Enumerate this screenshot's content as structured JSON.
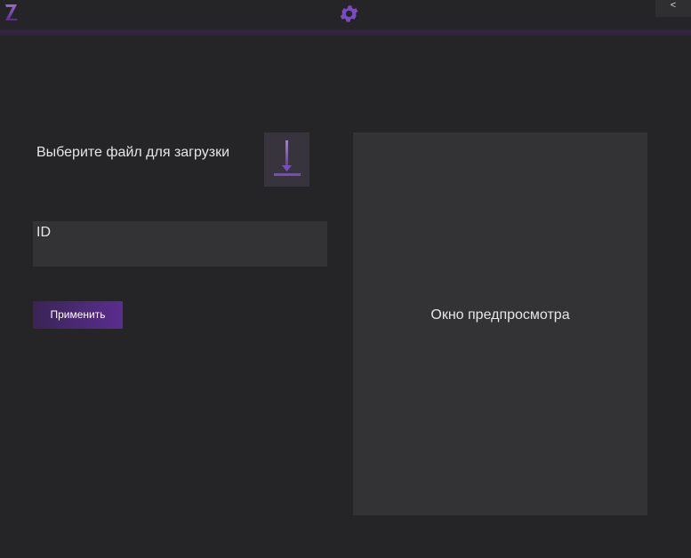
{
  "topbar": {
    "logo_icon": "z-logo-icon",
    "settings_icon": "gear-icon",
    "collapse_label": "<",
    "accent_color": "#7a4bbf"
  },
  "form": {
    "file_label": "Выберите файл для загрузки",
    "upload_icon": "download-arrow-icon",
    "id_value": "ID",
    "apply_label": "Применить"
  },
  "preview": {
    "label": "Окно предпросмотра"
  }
}
